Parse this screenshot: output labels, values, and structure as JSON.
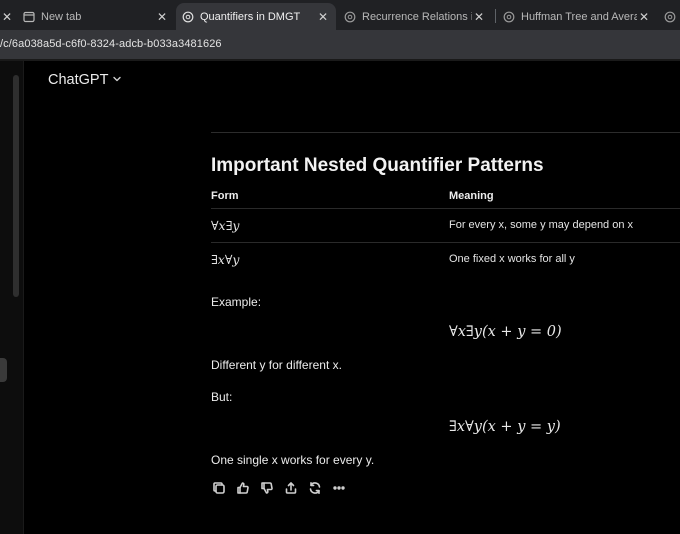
{
  "tabs": [
    {
      "title": "",
      "active": false,
      "icon": "close-icon"
    },
    {
      "title": "New tab",
      "active": false,
      "icon": "new-tab-icon"
    },
    {
      "title": "Quantifiers in DMGT",
      "active": true,
      "icon": "chatgpt-icon"
    },
    {
      "title": "Recurrence Relations in DMG",
      "active": false,
      "icon": "chatgpt-icon"
    },
    {
      "title": "Huffman Tree and Average",
      "active": false,
      "icon": "chatgpt-icon"
    },
    {
      "title": "",
      "active": false,
      "icon": "chatgpt-icon"
    }
  ],
  "address": {
    "url": "/c/6a038a5d-c6f0-8324-adcb-b033a3481626"
  },
  "header": {
    "model_label": "ChatGPT"
  },
  "message": {
    "heading": "Important Nested Quantifier Patterns",
    "table": {
      "columns": [
        "Form",
        "Meaning"
      ],
      "rows": [
        {
          "form": "∀x∃y",
          "meaning": "For every x, some y may depend on x"
        },
        {
          "form": "∃x∀y",
          "meaning": "One fixed x works for all y"
        }
      ]
    },
    "example_label": "Example:",
    "equation_1": "∀x∃y(x + y = 0)",
    "line_1": "Different y for different x.",
    "but_label": "But:",
    "equation_2": "∃x∀y(x + y = y)",
    "line_2": "One single x works for every y."
  },
  "actions": [
    "copy-icon",
    "thumbs-up-icon",
    "thumbs-down-icon",
    "share-icon",
    "regenerate-icon",
    "more-icon"
  ]
}
